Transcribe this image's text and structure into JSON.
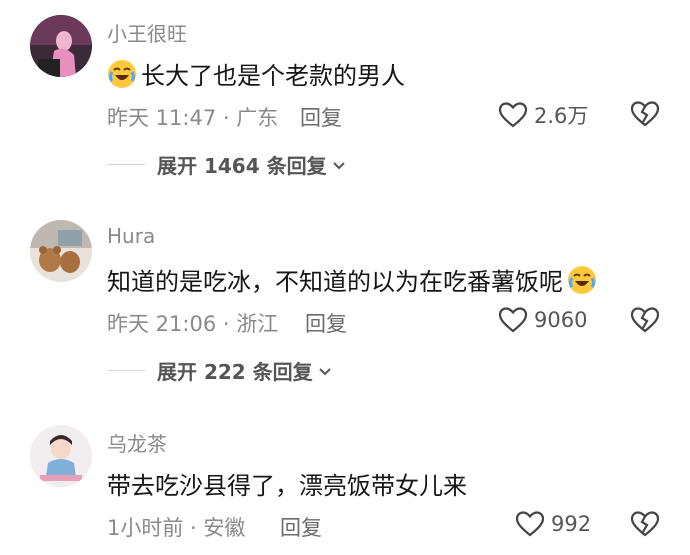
{
  "comments": [
    {
      "username": "小王很旺",
      "text": "长大了也是个老款的男人",
      "emoji_position": "start",
      "emoji": "crying-laughing-emoji",
      "meta": "昨天 11:47 · 广东",
      "reply": "回复",
      "likes": "2.6万",
      "expand": "展开 1464 条回复"
    },
    {
      "username": "Hura",
      "text": "知道的是吃冰，不知道的以为在吃番薯饭呢",
      "emoji_position": "end",
      "emoji": "crying-laughing-emoji",
      "meta": "昨天 21:06 · 浙江",
      "reply": "回复",
      "likes": "9060",
      "expand": "展开 222 条回复"
    },
    {
      "username": "乌龙茶",
      "text": "带去吃沙县得了，漂亮饭带女儿来",
      "meta": "1小时前 · 安徽",
      "reply": "回复",
      "likes": "992"
    }
  ],
  "colors": {
    "text": "#161616",
    "secondary": "#8a8a8a",
    "divider": "#d6d6d6",
    "emoji": "#ffc83d"
  },
  "icons": [
    "heart-outline-icon",
    "broken-heart-icon",
    "chevron-down-icon",
    "crying-laughing-emoji"
  ]
}
